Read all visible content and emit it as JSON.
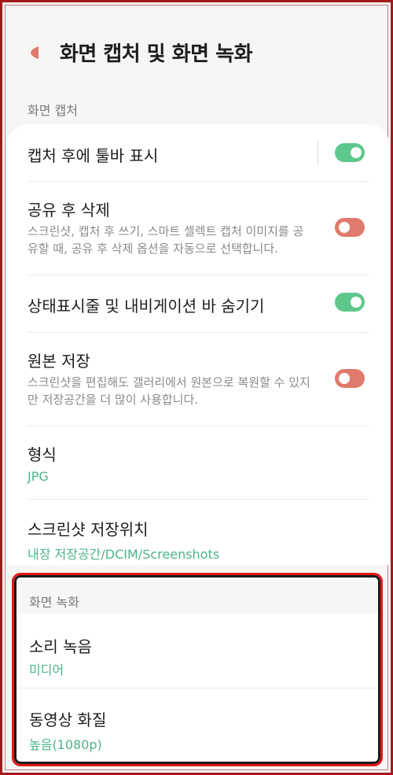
{
  "header": {
    "title": "화면 캡처 및 화면 녹화",
    "back_icon": "back-arrow-icon"
  },
  "capture_section": {
    "label": "화면 캡처",
    "items": [
      {
        "title": "캡처 후에 툴바 표시",
        "toggle": "on"
      },
      {
        "title": "공유 후 삭제",
        "description": "스크린샷, 캡처 후 쓰기, 스마트 셀렉트 캡처 이미지를 공유할 때, 공유 후 삭제 옵션을 자동으로 선택합니다.",
        "toggle": "off"
      },
      {
        "title": "상태표시줄 및 내비게이션 바 숨기기",
        "toggle": "on"
      },
      {
        "title": "원본 저장",
        "description": "스크린샷을 편집해도 갤러리에서 원본으로 복원할 수 있지만 저장공간을 더 많이 사용합니다.",
        "toggle": "off"
      },
      {
        "title": "형식",
        "value": "JPG"
      },
      {
        "title": "스크린샷 저장위치",
        "value": "내장 저장공간/DCIM/Screenshots"
      }
    ]
  },
  "record_section": {
    "label": "화면 녹화",
    "items": [
      {
        "title": "소리 녹음",
        "value": "미디어"
      },
      {
        "title": "동영상 화질",
        "value": "높음(1080p)"
      }
    ]
  },
  "colors": {
    "accent_green": "#4cb585",
    "toggle_on": "#5ec78c",
    "toggle_off": "#e07a6c",
    "highlight_border": "#e01a1a"
  }
}
